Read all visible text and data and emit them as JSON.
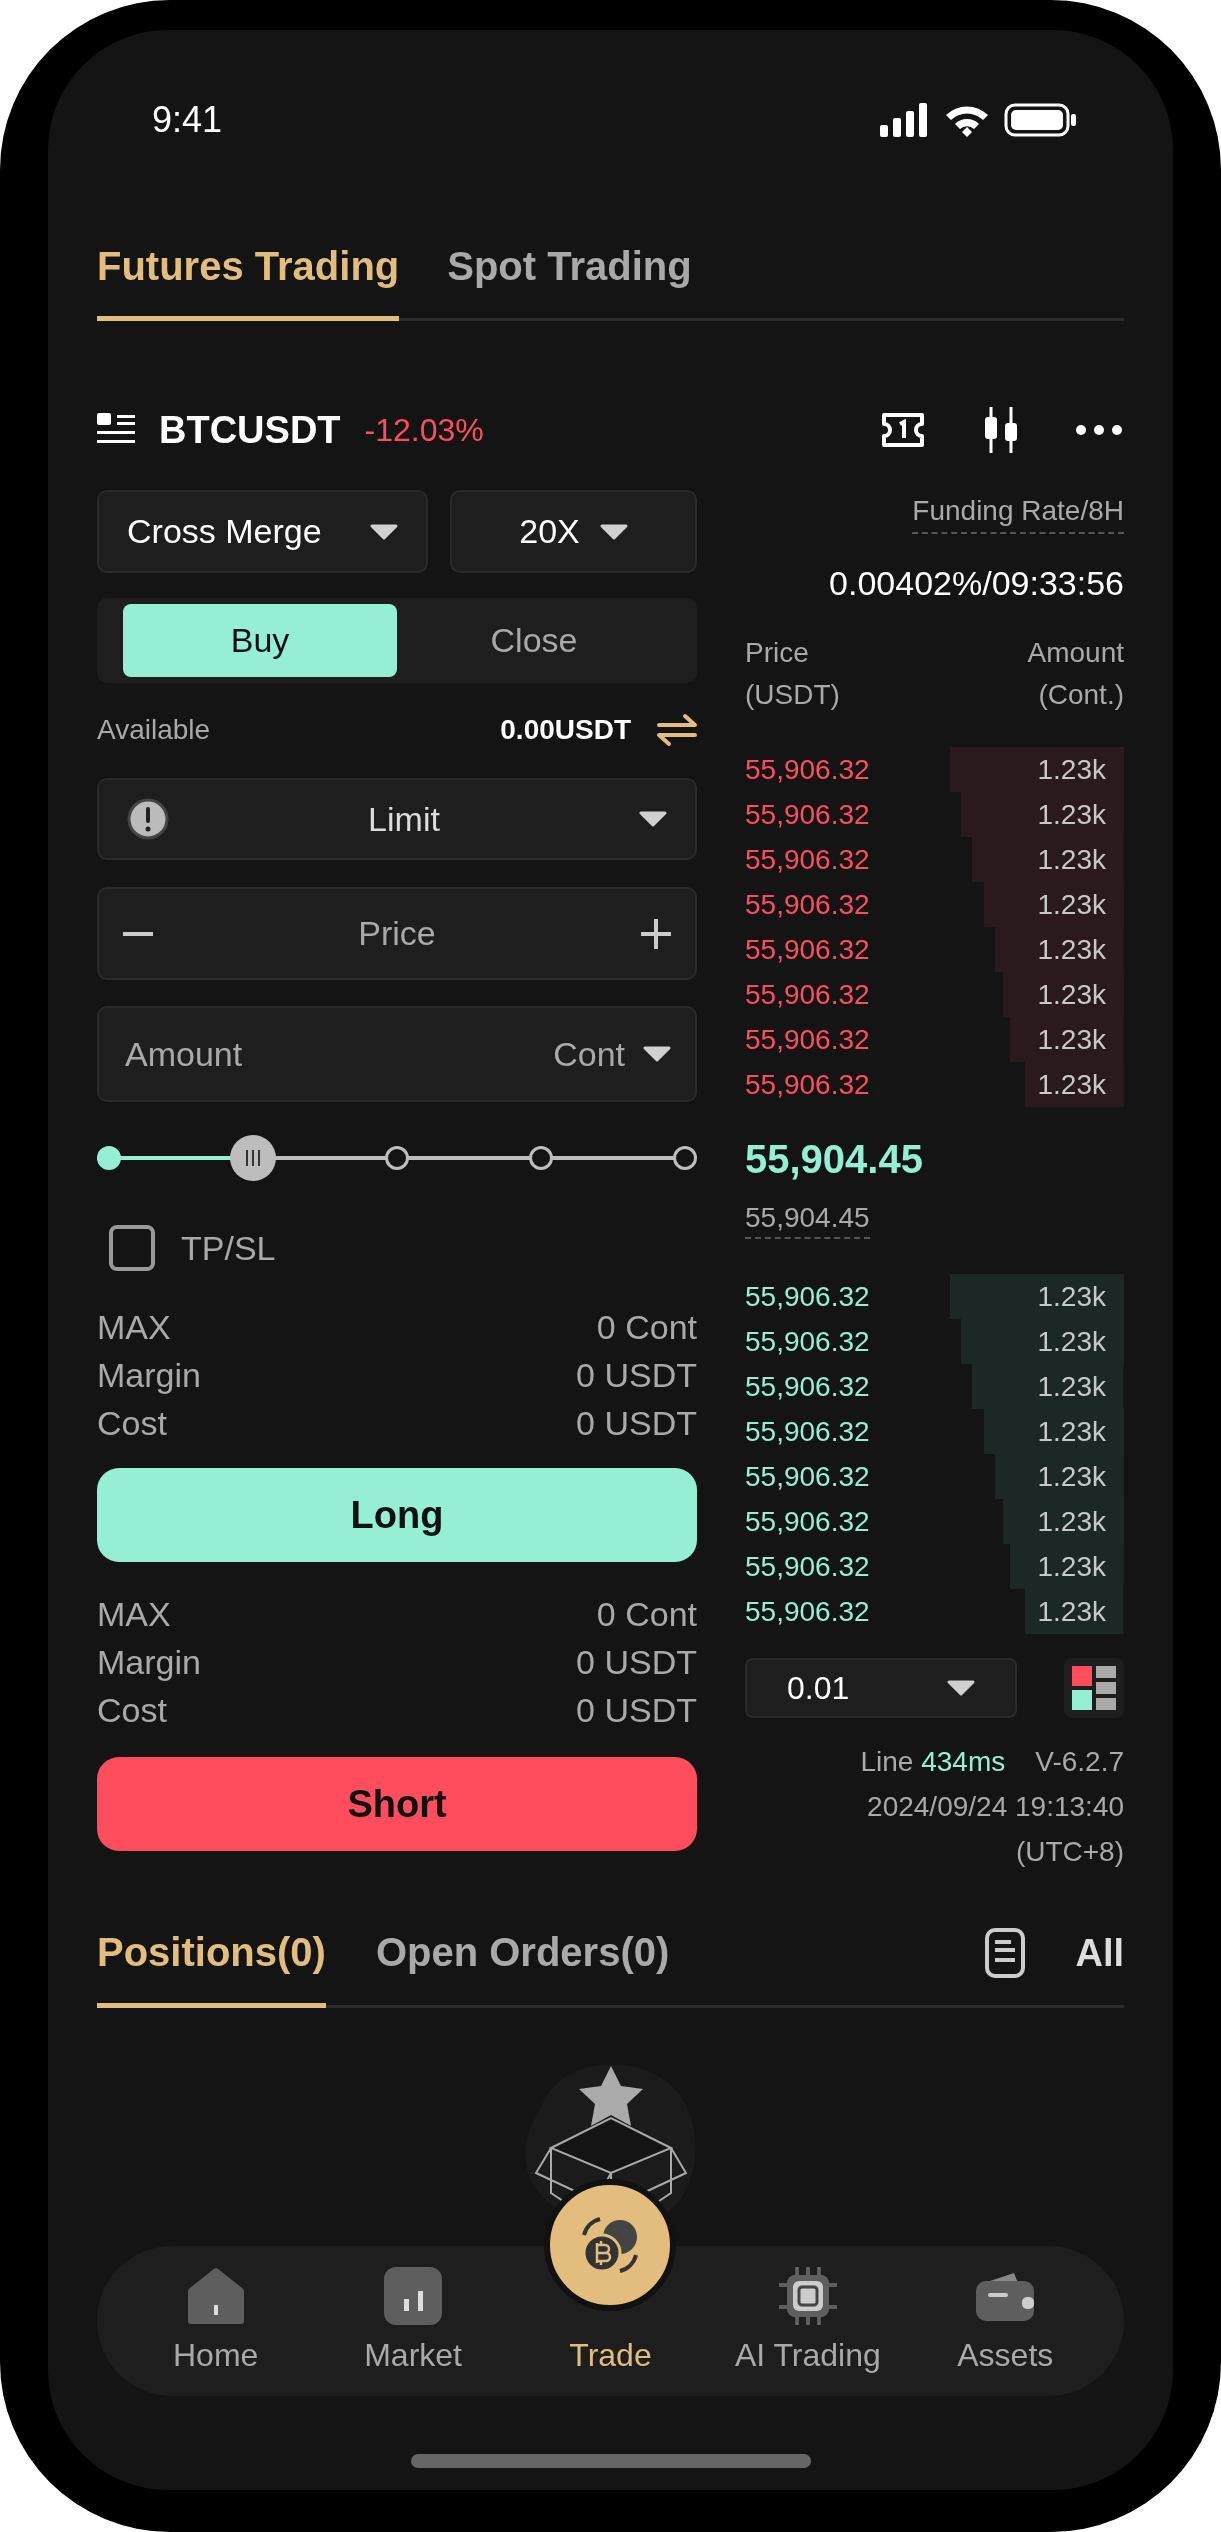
{
  "status_bar": {
    "time": "9:41"
  },
  "tabs": [
    {
      "label": "Futures Trading",
      "selected": true
    },
    {
      "label": "Spot Trading",
      "selected": false
    }
  ],
  "symbol": {
    "name": "BTCUSDT",
    "change": "-12.03%"
  },
  "margin_mode": "Cross Merge",
  "leverage": "20X",
  "side_tabs": [
    {
      "label": "Buy",
      "selected": true
    },
    {
      "label": "Close",
      "selected": false
    }
  ],
  "available": {
    "label": "Available",
    "value": "0.00USDT"
  },
  "order_type": "Limit",
  "price_field": {
    "placeholder": "Price"
  },
  "amount_field": {
    "placeholder": "Amount",
    "unit": "Cont"
  },
  "slider": {
    "level": 0.25
  },
  "tp_sl": {
    "label": "TP/SL",
    "checked": false
  },
  "long": {
    "stats": [
      {
        "label": "MAX",
        "value": "0 Cont"
      },
      {
        "label": "Margin",
        "value": "0 USDT"
      },
      {
        "label": "Cost",
        "value": "0 USDT"
      }
    ],
    "button": "Long"
  },
  "short": {
    "stats": [
      {
        "label": "MAX",
        "value": "0 Cont"
      },
      {
        "label": "Margin",
        "value": "0 USDT"
      },
      {
        "label": "Cost",
        "value": "0 USDT"
      }
    ],
    "button": "Short"
  },
  "funding": {
    "label": "Funding Rate/8H",
    "value": "0.00402%/09:33:56"
  },
  "order_book": {
    "columns": [
      {
        "title": "Price",
        "unit": "(USDT)"
      },
      {
        "title": "Amount",
        "unit": "(Cont.)"
      }
    ],
    "asks": [
      {
        "price": "55,906.32",
        "amount": "1.23k"
      },
      {
        "price": "55,906.32",
        "amount": "1.23k"
      },
      {
        "price": "55,906.32",
        "amount": "1.23k"
      },
      {
        "price": "55,906.32",
        "amount": "1.23k"
      },
      {
        "price": "55,906.32",
        "amount": "1.23k"
      },
      {
        "price": "55,906.32",
        "amount": "1.23k"
      },
      {
        "price": "55,906.32",
        "amount": "1.23k"
      },
      {
        "price": "55,906.32",
        "amount": "1.23k"
      }
    ],
    "last_price": "55,904.45",
    "mark_price": "55,904.45",
    "bids": [
      {
        "price": "55,906.32",
        "amount": "1.23k"
      },
      {
        "price": "55,906.32",
        "amount": "1.23k"
      },
      {
        "price": "55,906.32",
        "amount": "1.23k"
      },
      {
        "price": "55,906.32",
        "amount": "1.23k"
      },
      {
        "price": "55,906.32",
        "amount": "1.23k"
      },
      {
        "price": "55,906.32",
        "amount": "1.23k"
      },
      {
        "price": "55,906.32",
        "amount": "1.23k"
      },
      {
        "price": "55,906.32",
        "amount": "1.23k"
      }
    ],
    "precision": "0.01"
  },
  "connection": {
    "label": "Line",
    "latency": "434ms",
    "version": "V-6.2.7",
    "timestamp": "2024/09/24 19:13:40",
    "timezone": "(UTC+8)"
  },
  "bottom_tabs": [
    {
      "label": "Positions(0)",
      "selected": true
    },
    {
      "label": "Open Orders(0)",
      "selected": false
    }
  ],
  "filter": "All",
  "nav": [
    {
      "label": "Home",
      "selected": false
    },
    {
      "label": "Market",
      "selected": false
    },
    {
      "label": "Trade",
      "selected": true
    },
    {
      "label": "AI Trading",
      "selected": false
    },
    {
      "label": "Assets",
      "selected": false
    }
  ]
}
